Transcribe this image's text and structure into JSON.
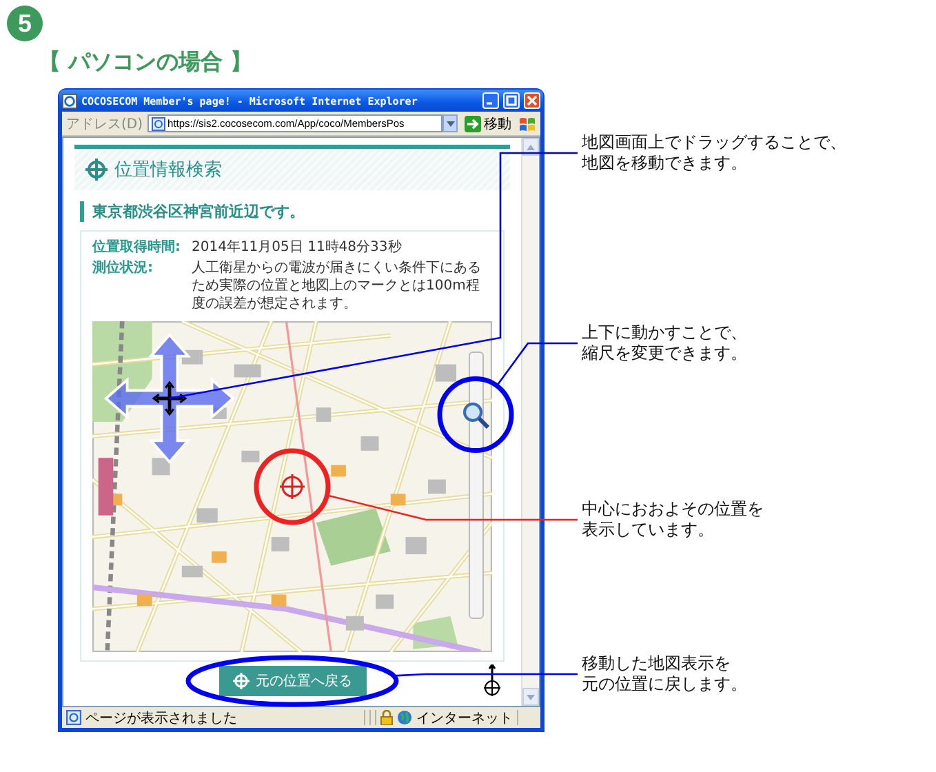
{
  "step": {
    "number": "5"
  },
  "heading": "【 パソコンの場合 】",
  "browser": {
    "title": "COCOSECOM Member's page! - Microsoft Internet Explorer",
    "address_label": "アドレス(D)",
    "url": "https://sis2.cocosecom.com/App/coco/MembersPos",
    "go_button": "移動",
    "status_text": "ページが表示されました",
    "zone": "インターネット"
  },
  "page": {
    "section_title": "位置情報検索",
    "location_heading": "東京都渋谷区神宮前近辺です。",
    "info": [
      {
        "label": "位置取得時間:",
        "value": "2014年11月05日 11時48分33秒"
      },
      {
        "label": "測位状況:",
        "value": "人工衛星からの電波が届きにくい条件下にあるため実際の位置と地図上のマークとは100m程度の誤差が想定されます。"
      }
    ],
    "zoom_slider": {
      "level": 0.8
    },
    "reset_button": "元の位置へ戻る"
  },
  "callouts": [
    {
      "kind": "line",
      "color": "#0000ee",
      "lines": [
        "地図画面上でドラッグすることで、",
        "地図を移動できます。"
      ]
    },
    {
      "kind": "circle",
      "color": "#0000ee",
      "lines": [
        "上下に動かすことで、",
        "縮尺を変更できます。"
      ]
    },
    {
      "kind": "circle",
      "color": "#ee2222",
      "lines": [
        "中心におおよその位置を",
        "表示しています。"
      ]
    },
    {
      "kind": "ellipse",
      "color": "#0000ee",
      "lines": [
        "移動した地図表示を",
        "元の位置に戻します。"
      ]
    }
  ]
}
